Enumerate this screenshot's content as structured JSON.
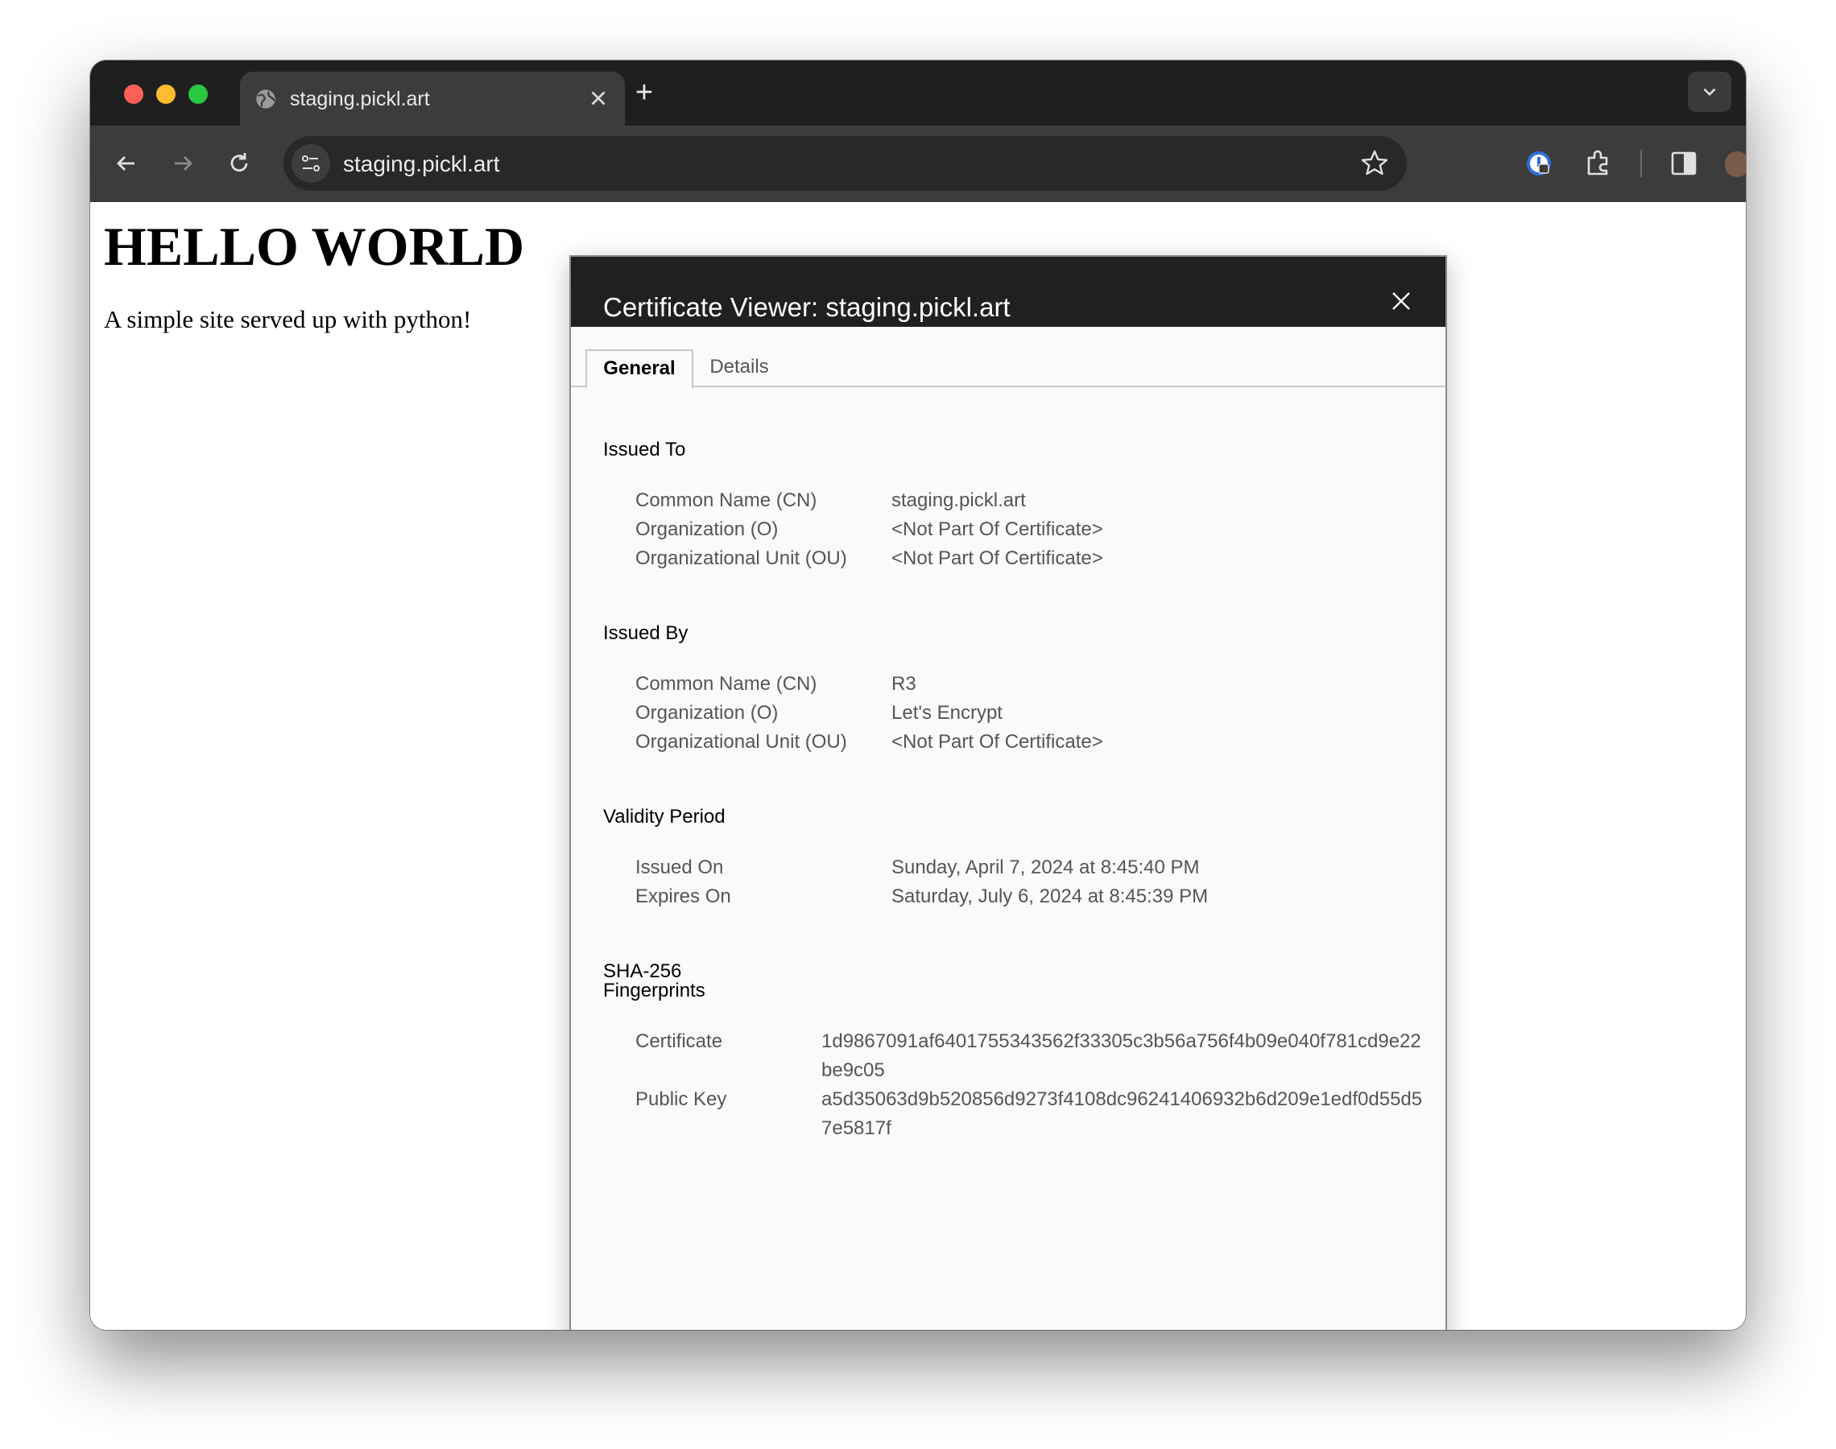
{
  "browser": {
    "tab_title": "staging.pickl.art",
    "new_tab_label": "+",
    "url": "staging.pickl.art"
  },
  "page": {
    "heading": "HELLO WORLD",
    "paragraph": "A simple site served up with python!"
  },
  "dialog": {
    "title": "Certificate Viewer: staging.pickl.art",
    "tabs": {
      "general": "General",
      "details": "Details"
    },
    "issued_to": {
      "title": "Issued To",
      "cn_label": "Common Name (CN)",
      "cn_value": "staging.pickl.art",
      "o_label": "Organization (O)",
      "o_value": "<Not Part Of Certificate>",
      "ou_label": "Organizational Unit (OU)",
      "ou_value": "<Not Part Of Certificate>"
    },
    "issued_by": {
      "title": "Issued By",
      "cn_label": "Common Name (CN)",
      "cn_value": "R3",
      "o_label": "Organization (O)",
      "o_value": "Let's Encrypt",
      "ou_label": "Organizational Unit (OU)",
      "ou_value": "<Not Part Of Certificate>"
    },
    "validity": {
      "title": "Validity Period",
      "issued_on_label": "Issued On",
      "issued_on_value": "Sunday, April 7, 2024 at 8:45:40 PM",
      "expires_on_label": "Expires On",
      "expires_on_value": "Saturday, July 6, 2024 at 8:45:39 PM"
    },
    "fingerprints": {
      "title_line1": "SHA-256",
      "title_line2": "Fingerprints",
      "certificate_label": "Certificate",
      "certificate_value": "1d9867091af6401755343562f33305c3b56a756f4b09e040f781cd9e22be9c05",
      "public_key_label": "Public Key",
      "public_key_value": "a5d35063d9b520856d9273f4108dc96241406932b6d209e1edf0d55d57e5817f"
    }
  },
  "colors": {
    "tabbar_bg": "#1f1f1f",
    "toolbar_bg": "#3c3c3c",
    "dialog_header_bg": "#202020",
    "dialog_body_bg": "#fafafa"
  }
}
